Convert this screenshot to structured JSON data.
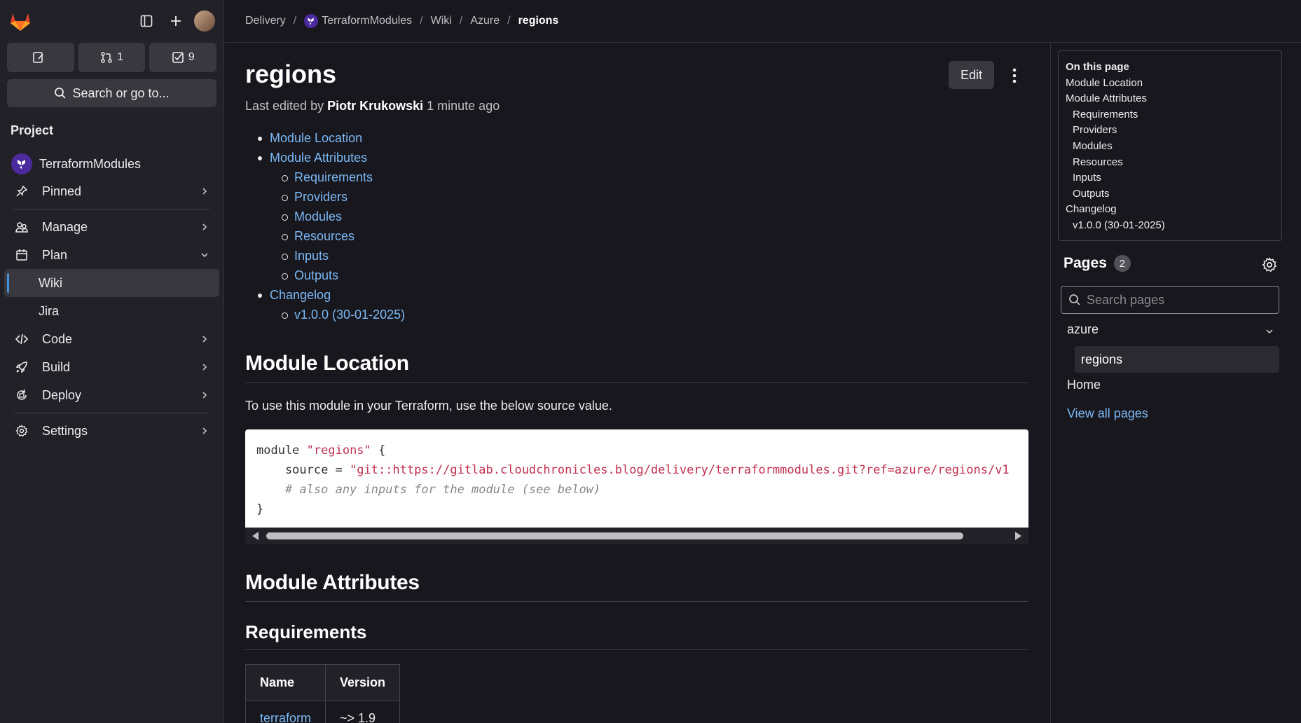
{
  "sidebar": {
    "counters": {
      "issues": "",
      "merge_requests": "1",
      "todos": "9"
    },
    "search_label": "Search or go to...",
    "section": "Project",
    "project_name": "TerraformModules",
    "items": [
      {
        "label": "Pinned"
      },
      {
        "label": "Manage"
      },
      {
        "label": "Plan"
      },
      {
        "label": "Wiki"
      },
      {
        "label": "Jira"
      },
      {
        "label": "Code"
      },
      {
        "label": "Build"
      },
      {
        "label": "Deploy"
      },
      {
        "label": "Settings"
      }
    ]
  },
  "breadcrumb": [
    "Delivery",
    "TerraformModules",
    "Wiki",
    "Azure",
    "regions"
  ],
  "page": {
    "title": "regions",
    "edit_label": "Edit",
    "edited_prefix": "Last edited by",
    "edited_author": "Piotr Krukowski",
    "edited_time": "1 minute ago",
    "toc": [
      "Module Location",
      "Module Attributes",
      "Requirements",
      "Providers",
      "Modules",
      "Resources",
      "Inputs",
      "Outputs",
      "Changelog",
      "v1.0.0 (30-01-2025)"
    ],
    "h_location": "Module Location",
    "location_text": "To use this module in your Terraform, use the below source value.",
    "code": {
      "l1_kw": "module ",
      "l1_str": "\"regions\"",
      "l1_end": " {",
      "l2_kw": "    source = ",
      "l2_str": "\"git::https://gitlab.cloudchronicles.blog/delivery/terraformmodules.git?ref=azure/regions/v1",
      "l3": "    # also any inputs for the module (see below)",
      "l4": "}"
    },
    "h_attributes": "Module Attributes",
    "h_requirements": "Requirements",
    "table": {
      "headers": [
        "Name",
        "Version"
      ],
      "rows": [
        [
          "terraform",
          "~> 1.9"
        ]
      ]
    }
  },
  "on_this_page": {
    "heading": "On this page",
    "items": [
      "Module Location",
      "Module Attributes",
      "Requirements",
      "Providers",
      "Modules",
      "Resources",
      "Inputs",
      "Outputs",
      "Changelog",
      "v1.0.0 (30-01-2025)"
    ]
  },
  "pages_panel": {
    "heading": "Pages",
    "count": "2",
    "search_placeholder": "Search pages",
    "folder": "azure",
    "active_page": "regions",
    "other_page": "Home",
    "view_all": "View all pages"
  }
}
